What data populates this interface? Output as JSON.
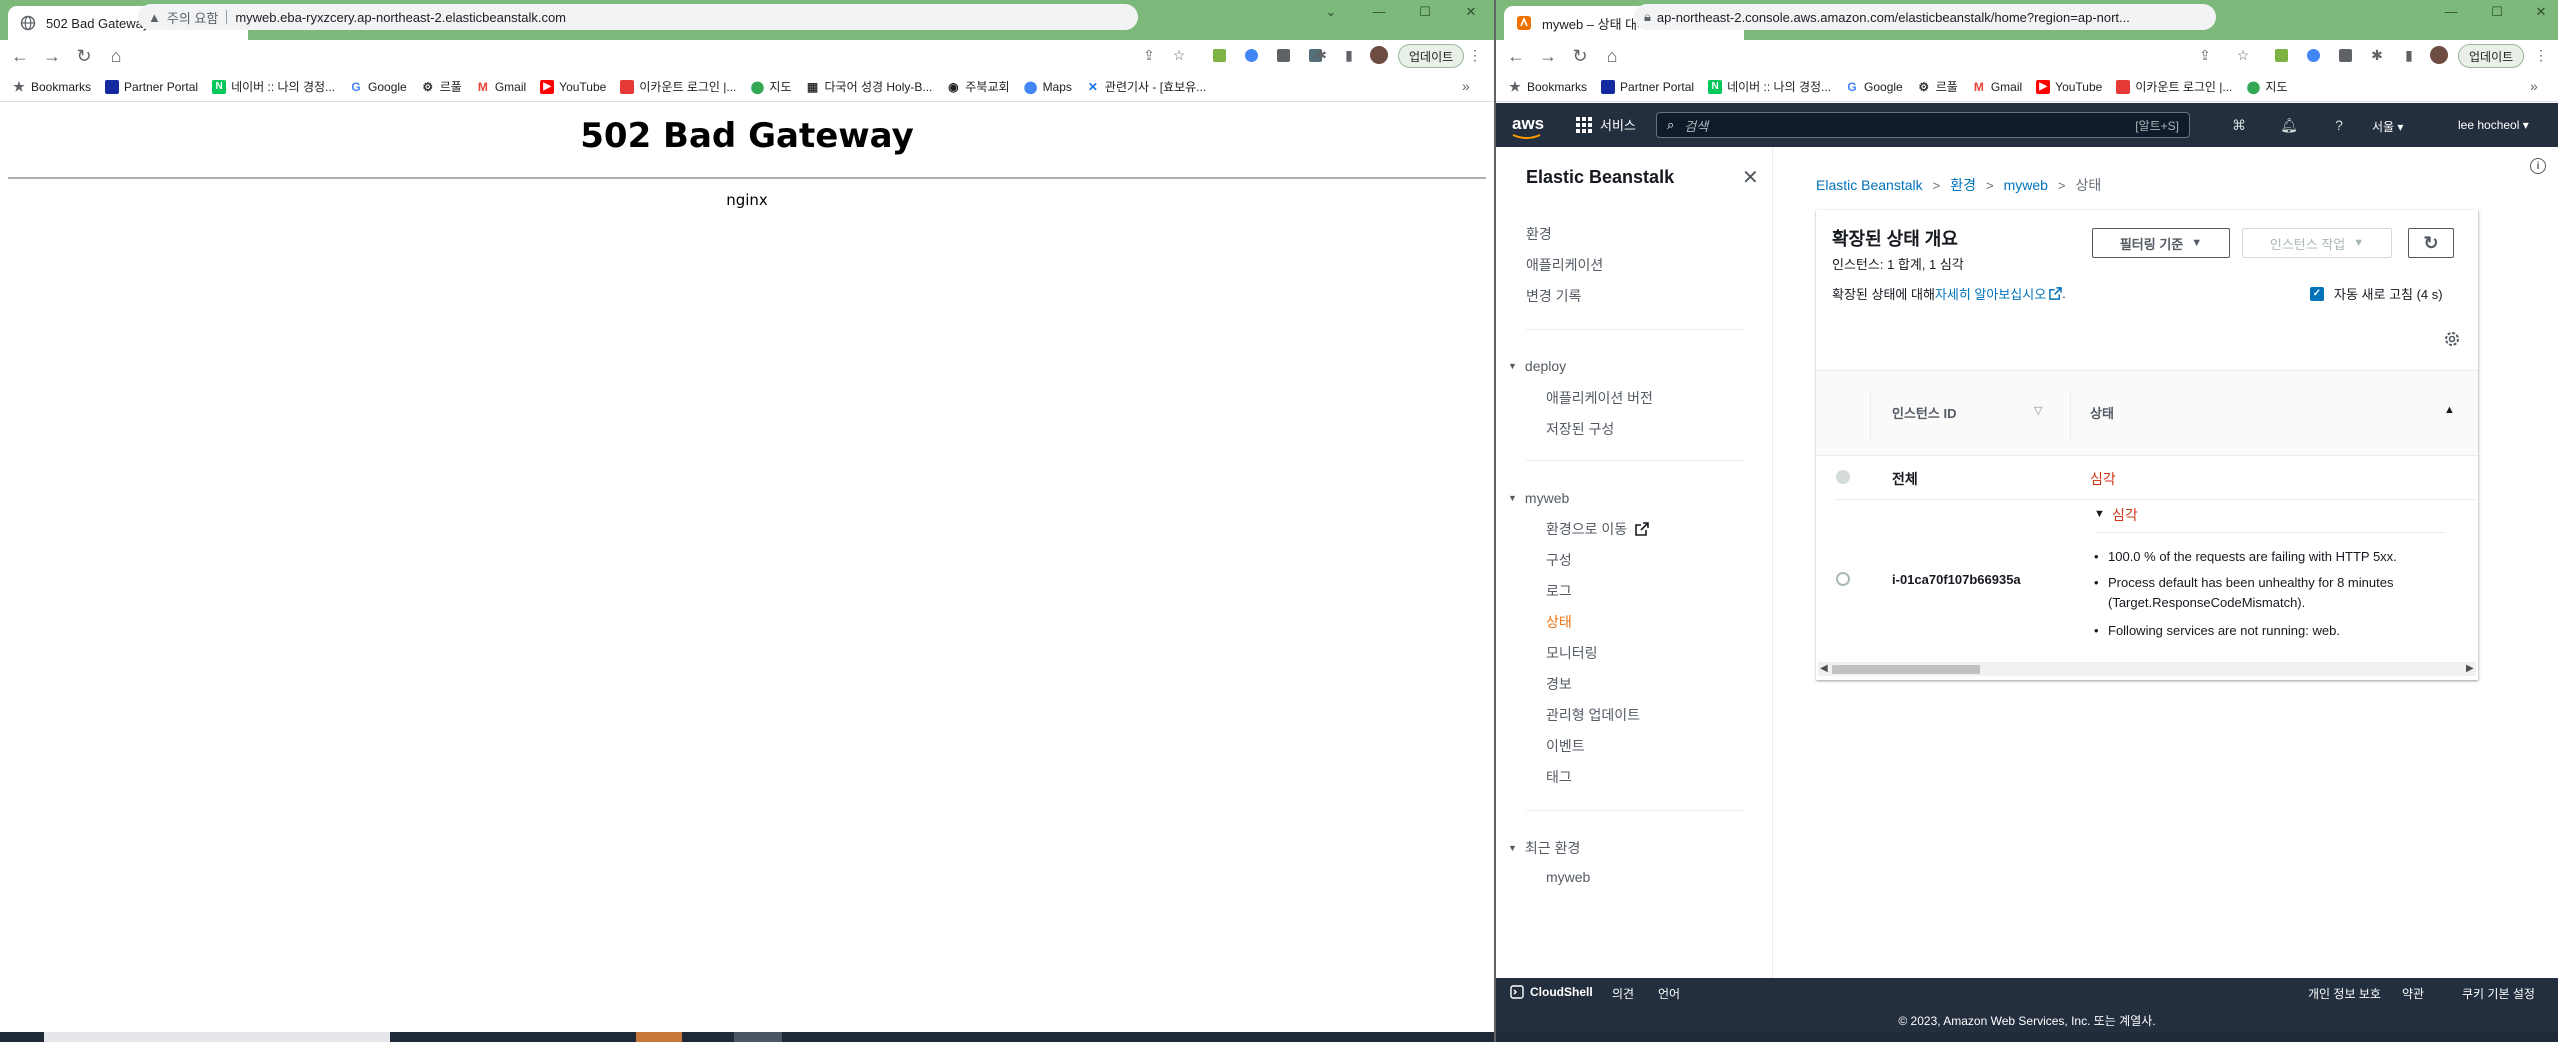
{
  "left_browser": {
    "tab_title": "502 Bad Gateway",
    "url": "myweb.eba-ryxzcery.ap-northeast-2.elasticbeanstalk.com",
    "security_label": "주의 요함",
    "update_label": "업데이트",
    "bookmarks": [
      "Bookmarks",
      "Partner Portal",
      "네이버 :: 나의 경정...",
      "Google",
      "르풀",
      "Gmail",
      "YouTube",
      "이카운트 로그인 |...",
      "지도",
      "다국어 성경 Holy-B...",
      "주북교회",
      "Maps",
      "관련기사 - [효보유..."
    ],
    "page": {
      "heading": "502 Bad Gateway",
      "server": "nginx"
    }
  },
  "right_browser": {
    "tab_title": "myweb – 상태 대시보드",
    "url": "ap-northeast-2.console.aws.amazon.com/elasticbeanstalk/home?region=ap-nort...",
    "update_label": "업데이트",
    "bookmarks": [
      "Bookmarks",
      "Partner Portal",
      "네이버 :: 나의 경정...",
      "Google",
      "르풀",
      "Gmail",
      "YouTube",
      "이카운트 로그인 |...",
      "지도"
    ]
  },
  "aws_nav": {
    "logo": "aws",
    "services": "서비스",
    "search_placeholder": "검색",
    "search_shortcut": "[알트+S]",
    "region": "서울 ▾",
    "user": "lee hocheol ▾"
  },
  "sidenav": {
    "title": "Elastic Beanstalk",
    "top_items": [
      "환경",
      "애플리케이션",
      "변경 기록"
    ],
    "deploy": {
      "label": "deploy",
      "items": [
        "애플리케이션 버전",
        "저장된 구성"
      ]
    },
    "myweb": {
      "label": "myweb",
      "items": [
        "환경으로 이동",
        "구성",
        "로그",
        "상태",
        "모니터링",
        "경보",
        "관리형 업데이트",
        "이벤트",
        "태그"
      ]
    },
    "recent": {
      "label": "최근 환경",
      "items": [
        "myweb"
      ]
    }
  },
  "breadcrumb": [
    "Elastic Beanstalk",
    "환경",
    "myweb",
    "상태"
  ],
  "health": {
    "title": "확장된 상태 개요",
    "subtitle": "인스턴스: 1 합계, 1 심각",
    "learn_prefix": "확장된 상태에 대해 ",
    "learn_link": "자세히 알아보십시오",
    "learn_suffix": ".",
    "filter_btn": "필터링 기준",
    "actions_btn": "인스턴스 작업",
    "auto_refresh": "자동 새로 고침 (4 s)",
    "columns": [
      "인스턴스 ID",
      "상태"
    ],
    "overall": {
      "label": "전체",
      "status": "심각"
    },
    "instance": {
      "id": "i-01ca70f107b66935a",
      "status": "심각",
      "causes": [
        "100.0 % of the requests are failing with HTTP 5xx.",
        "Process default has been unhealthy for 8 minutes (Target.ResponseCodeMismatch).",
        "Following services are not running: web."
      ]
    }
  },
  "footer": {
    "cloudshell": "CloudShell",
    "feedback": "의견",
    "language": "언어",
    "privacy": "개인 정보 보호",
    "terms": "약관",
    "cookies": "쿠키 기본 설정",
    "copyright": "© 2023, Amazon Web Services, Inc. 또는 계열사."
  },
  "colors": {
    "chrome_frame": "#7cb97a",
    "aws_nav": "#232f3e",
    "link": "#0073bb",
    "severe": "#d13212",
    "active_nav": "#ec7211"
  }
}
